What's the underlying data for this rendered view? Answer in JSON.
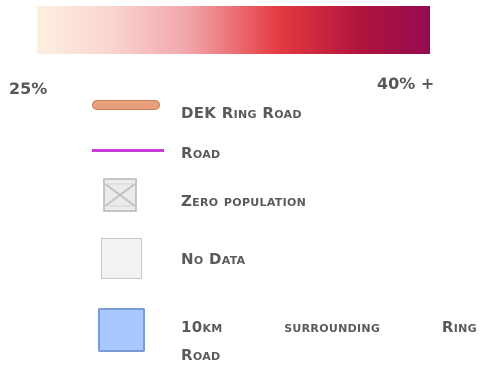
{
  "scale": {
    "min_label": "25%",
    "max_label": "40% +",
    "colors": [
      "#fcf0df",
      "#fad6d2",
      "#f2a7ac",
      "#e4393f",
      "#b1143d",
      "#950b52"
    ]
  },
  "legend": {
    "ring_road": {
      "label": "DEK Ring Road",
      "color": "#e8a07a"
    },
    "road": {
      "label": "Road",
      "color": "#cb3dd8"
    },
    "zero_population": {
      "label": "Zero population"
    },
    "no_data": {
      "label": "No Data",
      "color": "#f2f2f2"
    },
    "buffer": {
      "words": [
        "10km",
        "surrounding",
        "Ring"
      ],
      "line2": "Road",
      "color": "#a8c8ff"
    }
  }
}
